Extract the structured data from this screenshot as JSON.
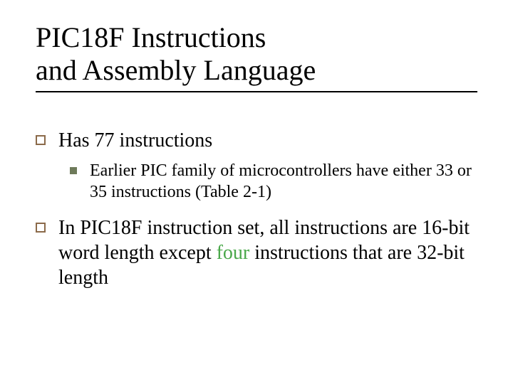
{
  "title_line1": "PIC18F Instructions",
  "title_line2": "and Assembly Language",
  "bullets": {
    "b1": "Has 77 instructions",
    "b1_sub": "Earlier PIC family of microcontrollers have either 33 or 35 instructions (Table 2-1)",
    "b2_pre": "In PIC18F instruction set, all instructions are 16-bit word length except ",
    "b2_hl": "four",
    "b2_post": " instructions that are 32-bit length"
  }
}
